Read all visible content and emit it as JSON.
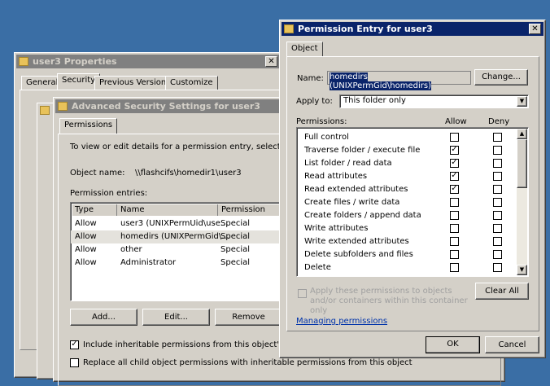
{
  "properties": {
    "title": "user3 Properties",
    "tabs": [
      "General",
      "Security",
      "Previous Versions",
      "Customize"
    ],
    "active_tab": "Security"
  },
  "advanced": {
    "title": "Advanced Security Settings for user3",
    "tab": "Permissions",
    "intro": "To view or edit details for a permission entry, select the entry",
    "object_label": "Object name:",
    "object_value": "\\\\flashcifs\\homedir1\\user3",
    "entries_label": "Permission entries:",
    "columns": [
      "Type",
      "Name",
      "Permission"
    ],
    "rows": [
      {
        "type": "Allow",
        "name": "user3 (UNIXPermUid\\use...",
        "permission": "Special"
      },
      {
        "type": "Allow",
        "name": "homedirs (UNIXPermGid\\...",
        "permission": "Special",
        "selected": true
      },
      {
        "type": "Allow",
        "name": "other",
        "permission": "Special"
      },
      {
        "type": "Allow",
        "name": "Administrator",
        "permission": "Special"
      }
    ],
    "add": "Add...",
    "edit": "Edit...",
    "remove": "Remove",
    "include_inherit": {
      "label": "Include inheritable permissions from this object's parent",
      "checked": true
    },
    "replace_child": {
      "label": "Replace all child object permissions with inheritable permissions from this object",
      "checked": false
    }
  },
  "entry": {
    "title": "Permission Entry for user3",
    "tab": "Object",
    "name_label": "Name:",
    "name_value": "homedirs (UNIXPermGid\\homedirs)",
    "change": "Change...",
    "apply_label": "Apply to:",
    "apply_value": "This folder only",
    "perm_label": "Permissions:",
    "allow_label": "Allow",
    "deny_label": "Deny",
    "perms": [
      {
        "name": "Full control",
        "allow": false,
        "deny": false
      },
      {
        "name": "Traverse folder / execute file",
        "allow": true,
        "deny": false
      },
      {
        "name": "List folder / read data",
        "allow": true,
        "deny": false
      },
      {
        "name": "Read attributes",
        "allow": true,
        "deny": false
      },
      {
        "name": "Read extended attributes",
        "allow": true,
        "deny": false
      },
      {
        "name": "Create files / write data",
        "allow": false,
        "deny": false
      },
      {
        "name": "Create folders / append data",
        "allow": false,
        "deny": false
      },
      {
        "name": "Write attributes",
        "allow": false,
        "deny": false
      },
      {
        "name": "Write extended attributes",
        "allow": false,
        "deny": false
      },
      {
        "name": "Delete subfolders and files",
        "allow": false,
        "deny": false
      },
      {
        "name": "Delete",
        "allow": false,
        "deny": false
      }
    ],
    "apply_inherit": "Apply these permissions to objects and/or containers within this container only",
    "clear_all": "Clear All",
    "managing": "Managing permissions",
    "ok": "OK",
    "cancel": "Cancel"
  }
}
